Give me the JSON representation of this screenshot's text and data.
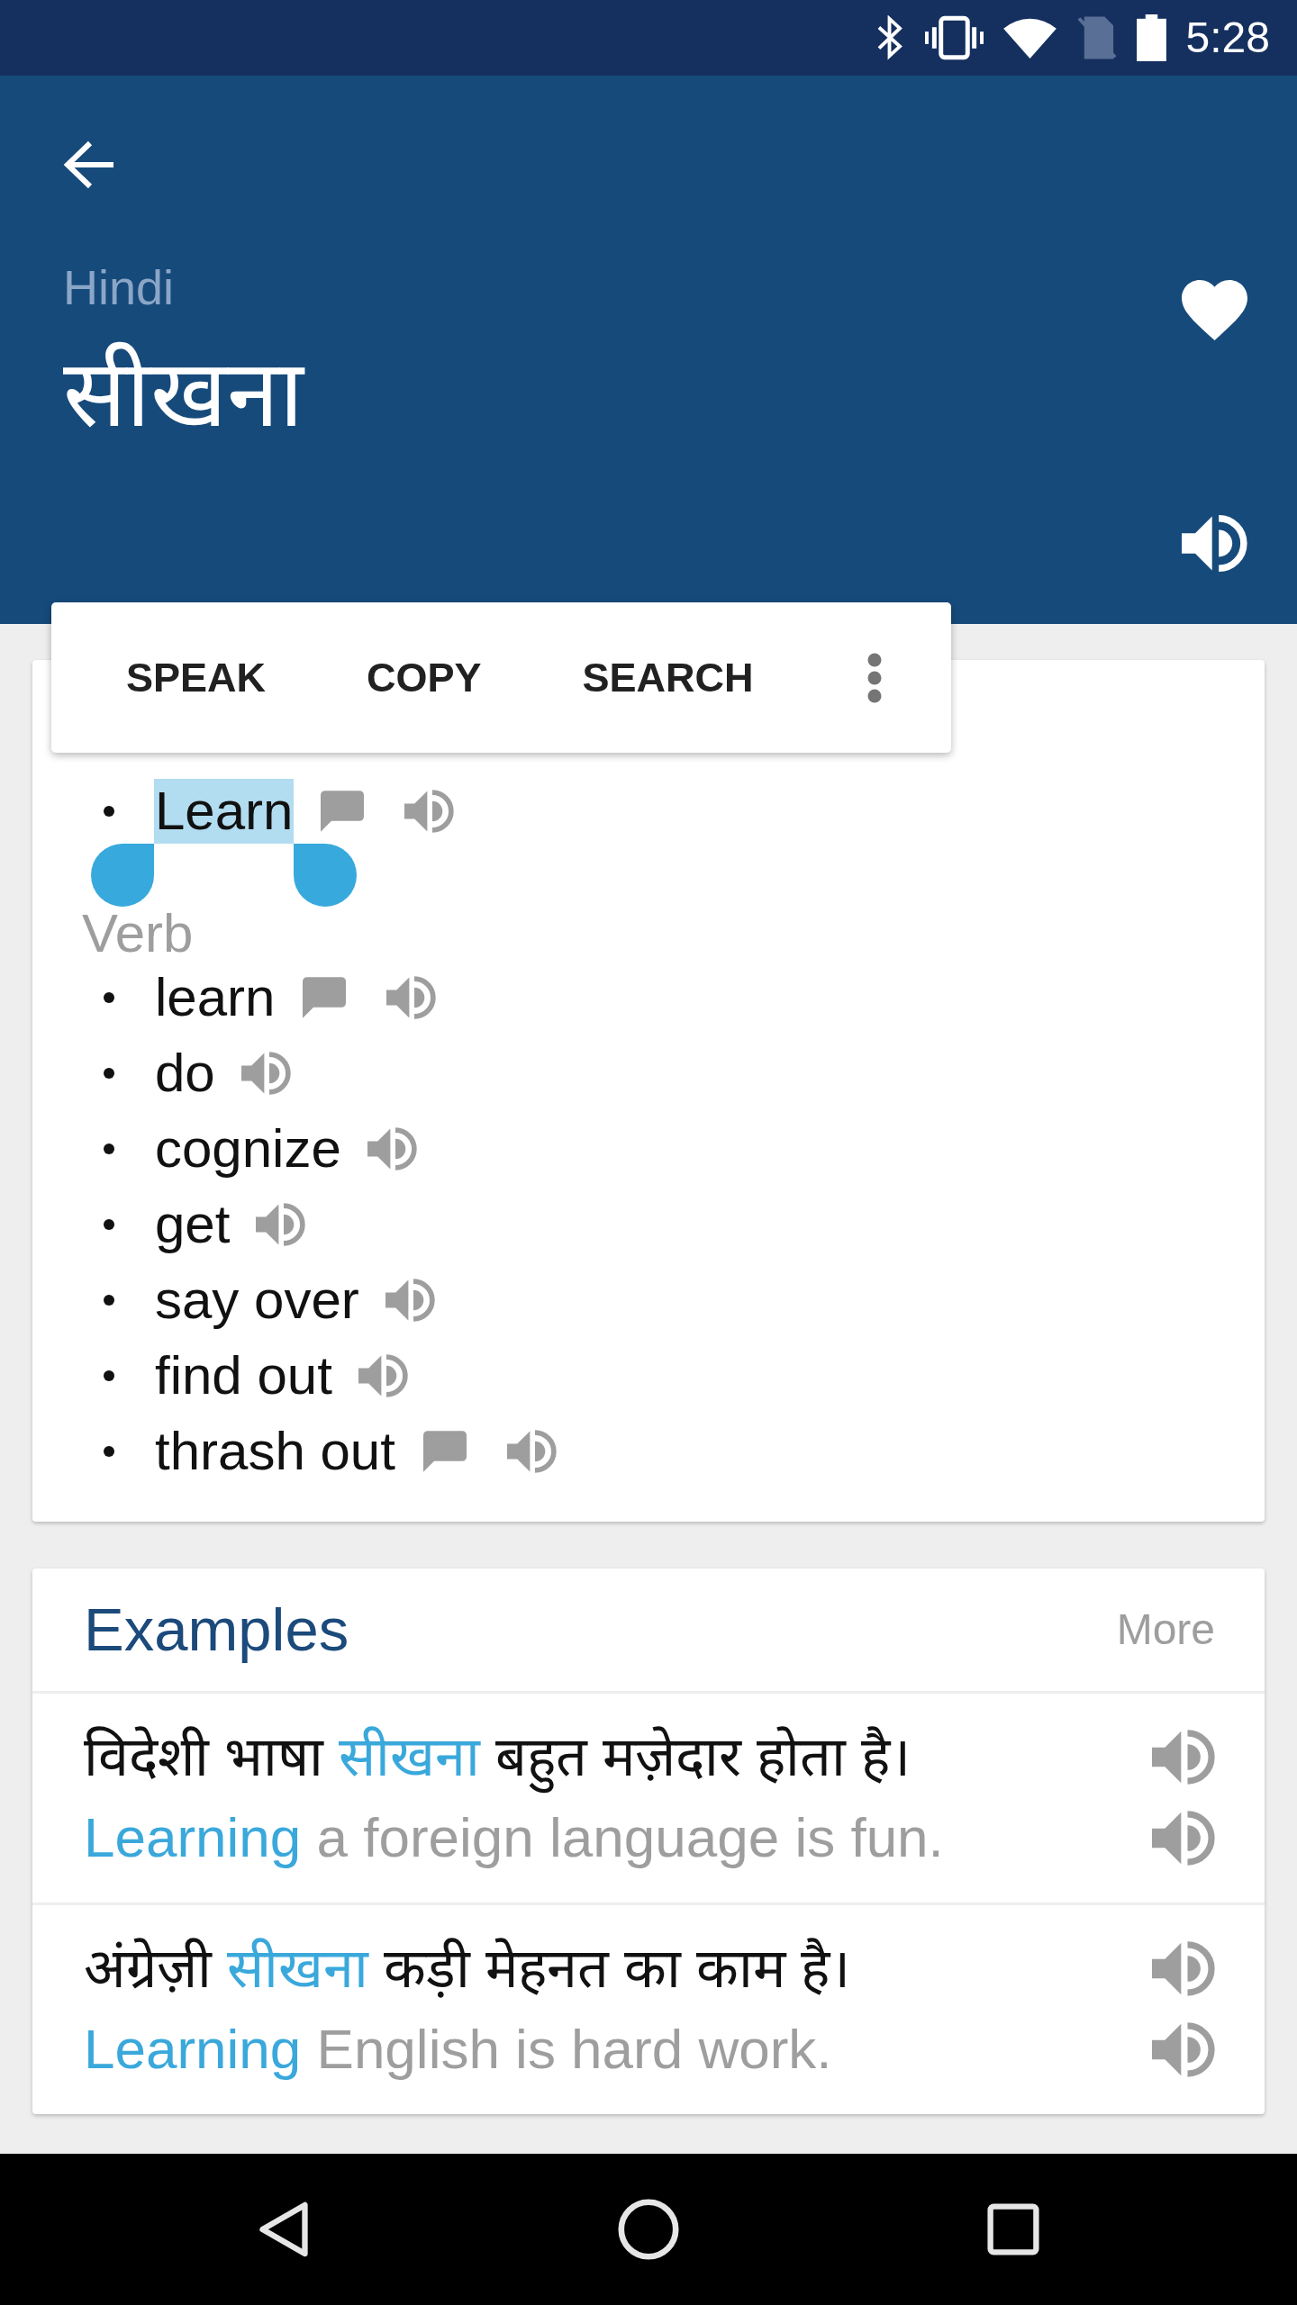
{
  "status_bar": {
    "time": "5:28"
  },
  "header": {
    "language": "Hindi",
    "word": "सीखना"
  },
  "selection_toolbar": {
    "actions": [
      "SPEAK",
      "COPY",
      "SEARCH"
    ]
  },
  "definitions": {
    "groups": [
      {
        "entries": [
          {
            "text": "Learn",
            "kind": "annotated",
            "selected": true
          }
        ]
      },
      {
        "heading": "Verb",
        "entries": [
          {
            "text": "learn",
            "kind": "annotated",
            "selected": false
          },
          {
            "text": "do",
            "kind": "plain",
            "selected": false
          },
          {
            "text": "cognize",
            "kind": "plain",
            "selected": false
          },
          {
            "text": "get",
            "kind": "plain",
            "selected": false
          },
          {
            "text": "say over",
            "kind": "plain",
            "selected": false
          },
          {
            "text": "find out",
            "kind": "plain",
            "selected": false
          },
          {
            "text": "thrash out",
            "kind": "annotated",
            "selected": false
          }
        ]
      }
    ]
  },
  "examples": {
    "title": "Examples",
    "more": "More",
    "items": [
      {
        "source": [
          {
            "text": "विदेशी भाषा ",
            "highlight": false
          },
          {
            "text": "सीखना",
            "highlight": true
          },
          {
            "text": " बहुत मज़ेदार होता है।",
            "highlight": false
          }
        ],
        "translation": [
          {
            "text": "Learning",
            "highlight": true
          },
          {
            "text": " a foreign language is fun.",
            "highlight": false
          }
        ]
      },
      {
        "source": [
          {
            "text": "अंग्रेज़ी ",
            "highlight": false
          },
          {
            "text": "सीखना",
            "highlight": true
          },
          {
            "text": " कड़ी मेहनत का काम है।",
            "highlight": false
          }
        ],
        "translation": [
          {
            "text": "Learning",
            "highlight": true
          },
          {
            "text": " English is hard work.",
            "highlight": false
          }
        ]
      }
    ]
  }
}
